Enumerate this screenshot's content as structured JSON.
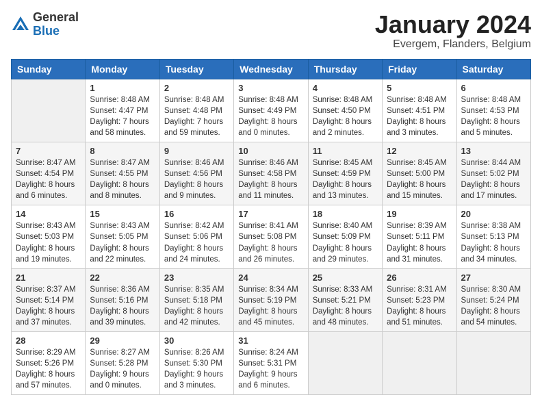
{
  "header": {
    "logo_line1": "General",
    "logo_line2": "Blue",
    "month": "January 2024",
    "location": "Evergem, Flanders, Belgium"
  },
  "weekdays": [
    "Sunday",
    "Monday",
    "Tuesday",
    "Wednesday",
    "Thursday",
    "Friday",
    "Saturday"
  ],
  "weeks": [
    [
      {
        "day": "",
        "info": ""
      },
      {
        "day": "1",
        "info": "Sunrise: 8:48 AM\nSunset: 4:47 PM\nDaylight: 7 hours\nand 58 minutes."
      },
      {
        "day": "2",
        "info": "Sunrise: 8:48 AM\nSunset: 4:48 PM\nDaylight: 7 hours\nand 59 minutes."
      },
      {
        "day": "3",
        "info": "Sunrise: 8:48 AM\nSunset: 4:49 PM\nDaylight: 8 hours\nand 0 minutes."
      },
      {
        "day": "4",
        "info": "Sunrise: 8:48 AM\nSunset: 4:50 PM\nDaylight: 8 hours\nand 2 minutes."
      },
      {
        "day": "5",
        "info": "Sunrise: 8:48 AM\nSunset: 4:51 PM\nDaylight: 8 hours\nand 3 minutes."
      },
      {
        "day": "6",
        "info": "Sunrise: 8:48 AM\nSunset: 4:53 PM\nDaylight: 8 hours\nand 5 minutes."
      }
    ],
    [
      {
        "day": "7",
        "info": "Sunrise: 8:47 AM\nSunset: 4:54 PM\nDaylight: 8 hours\nand 6 minutes."
      },
      {
        "day": "8",
        "info": "Sunrise: 8:47 AM\nSunset: 4:55 PM\nDaylight: 8 hours\nand 8 minutes."
      },
      {
        "day": "9",
        "info": "Sunrise: 8:46 AM\nSunset: 4:56 PM\nDaylight: 8 hours\nand 9 minutes."
      },
      {
        "day": "10",
        "info": "Sunrise: 8:46 AM\nSunset: 4:58 PM\nDaylight: 8 hours\nand 11 minutes."
      },
      {
        "day": "11",
        "info": "Sunrise: 8:45 AM\nSunset: 4:59 PM\nDaylight: 8 hours\nand 13 minutes."
      },
      {
        "day": "12",
        "info": "Sunrise: 8:45 AM\nSunset: 5:00 PM\nDaylight: 8 hours\nand 15 minutes."
      },
      {
        "day": "13",
        "info": "Sunrise: 8:44 AM\nSunset: 5:02 PM\nDaylight: 8 hours\nand 17 minutes."
      }
    ],
    [
      {
        "day": "14",
        "info": "Sunrise: 8:43 AM\nSunset: 5:03 PM\nDaylight: 8 hours\nand 19 minutes."
      },
      {
        "day": "15",
        "info": "Sunrise: 8:43 AM\nSunset: 5:05 PM\nDaylight: 8 hours\nand 22 minutes."
      },
      {
        "day": "16",
        "info": "Sunrise: 8:42 AM\nSunset: 5:06 PM\nDaylight: 8 hours\nand 24 minutes."
      },
      {
        "day": "17",
        "info": "Sunrise: 8:41 AM\nSunset: 5:08 PM\nDaylight: 8 hours\nand 26 minutes."
      },
      {
        "day": "18",
        "info": "Sunrise: 8:40 AM\nSunset: 5:09 PM\nDaylight: 8 hours\nand 29 minutes."
      },
      {
        "day": "19",
        "info": "Sunrise: 8:39 AM\nSunset: 5:11 PM\nDaylight: 8 hours\nand 31 minutes."
      },
      {
        "day": "20",
        "info": "Sunrise: 8:38 AM\nSunset: 5:13 PM\nDaylight: 8 hours\nand 34 minutes."
      }
    ],
    [
      {
        "day": "21",
        "info": "Sunrise: 8:37 AM\nSunset: 5:14 PM\nDaylight: 8 hours\nand 37 minutes."
      },
      {
        "day": "22",
        "info": "Sunrise: 8:36 AM\nSunset: 5:16 PM\nDaylight: 8 hours\nand 39 minutes."
      },
      {
        "day": "23",
        "info": "Sunrise: 8:35 AM\nSunset: 5:18 PM\nDaylight: 8 hours\nand 42 minutes."
      },
      {
        "day": "24",
        "info": "Sunrise: 8:34 AM\nSunset: 5:19 PM\nDaylight: 8 hours\nand 45 minutes."
      },
      {
        "day": "25",
        "info": "Sunrise: 8:33 AM\nSunset: 5:21 PM\nDaylight: 8 hours\nand 48 minutes."
      },
      {
        "day": "26",
        "info": "Sunrise: 8:31 AM\nSunset: 5:23 PM\nDaylight: 8 hours\nand 51 minutes."
      },
      {
        "day": "27",
        "info": "Sunrise: 8:30 AM\nSunset: 5:24 PM\nDaylight: 8 hours\nand 54 minutes."
      }
    ],
    [
      {
        "day": "28",
        "info": "Sunrise: 8:29 AM\nSunset: 5:26 PM\nDaylight: 8 hours\nand 57 minutes."
      },
      {
        "day": "29",
        "info": "Sunrise: 8:27 AM\nSunset: 5:28 PM\nDaylight: 9 hours\nand 0 minutes."
      },
      {
        "day": "30",
        "info": "Sunrise: 8:26 AM\nSunset: 5:30 PM\nDaylight: 9 hours\nand 3 minutes."
      },
      {
        "day": "31",
        "info": "Sunrise: 8:24 AM\nSunset: 5:31 PM\nDaylight: 9 hours\nand 6 minutes."
      },
      {
        "day": "",
        "info": ""
      },
      {
        "day": "",
        "info": ""
      },
      {
        "day": "",
        "info": ""
      }
    ]
  ]
}
